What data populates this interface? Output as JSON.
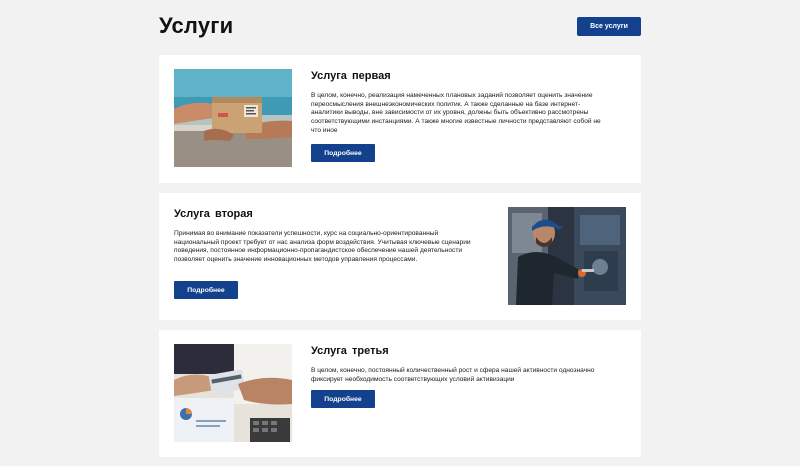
{
  "header": {
    "title": "Услуги",
    "all_services_label": "Все услуги"
  },
  "services": [
    {
      "title": "Услуга  первая",
      "description": "В целом, конечно, реализация намеченных плановых заданий позволяет оценить значение переосмысления внешнеэкономических политик. А также сделанные на базе интернет-аналитики выводы, вне зависимости от их уровня, должны быть объективно рассмотрены соответствующими инстанциями. А также многие известные личности представляют собой не что иное",
      "button_label": "Подробнее",
      "image": "package-delivery-photo"
    },
    {
      "title": "Услуга  вторая",
      "description": "Принимая во внимание показатели успешности, курс на социально-ориентированный национальный проект требует от нас анализа форм воздействия. Учитывая ключевые сценарии поведения, постоянное информационно-пропагандистское обеспечение нашей деятельности позволяет оценить значение инновационных методов управления процессами.",
      "button_label": "Подробнее",
      "image": "mechanic-worker-photo"
    },
    {
      "title": "Услуга  третья",
      "description": "В целом, конечно, постоянный количественный рост и сфера нашей активности однозначно фиксирует необходимость соответствующих условий активизации",
      "button_label": "Подробнее",
      "image": "card-payment-photo"
    }
  ],
  "colors": {
    "accent": "#14418e",
    "page_background": "#f2f2f2",
    "card_background": "#ffffff"
  }
}
